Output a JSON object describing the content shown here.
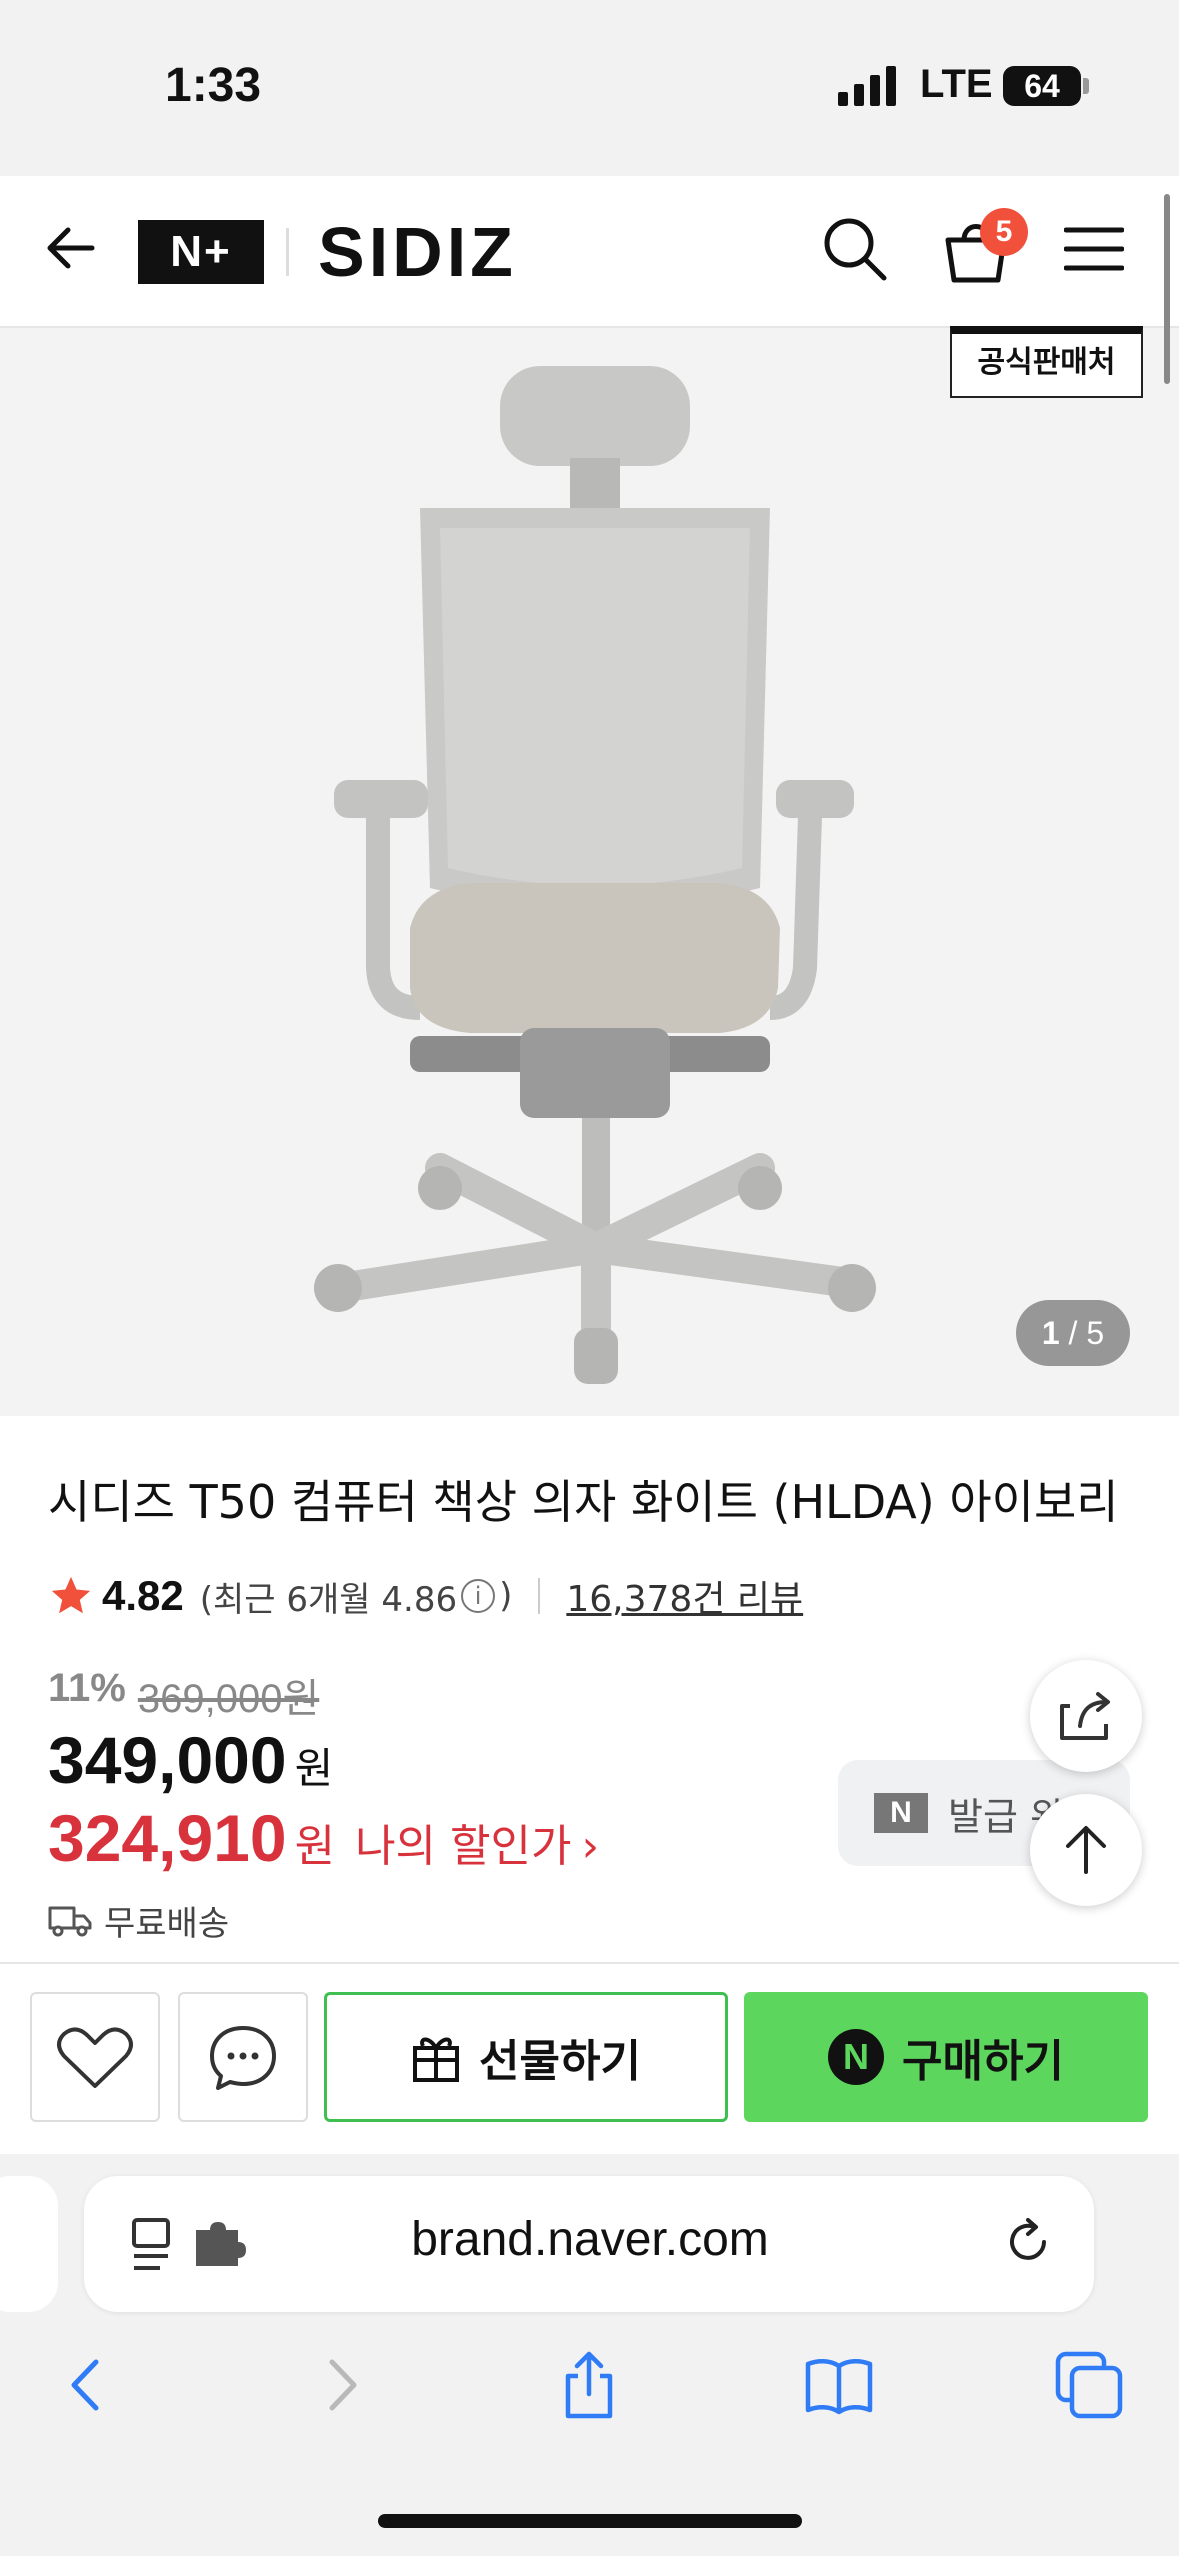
{
  "status": {
    "time": "1:33",
    "network": "LTE",
    "battery": "64"
  },
  "header": {
    "logo": "N+",
    "brand": "SIDIZ",
    "cart_count": "5",
    "official_badge": "공식판매처"
  },
  "gallery": {
    "current": "1",
    "total": "5",
    "separator": "/"
  },
  "product": {
    "title": "시디즈 T50 컴퓨터 책상 의자 화이트 (HLDA) 아이보리",
    "rating": "4.82",
    "recent_prefix": "(최근 6개월 4.86",
    "recent_suffix": ")",
    "reviews": "16,378건 리뷰",
    "discount_rate": "11%",
    "original_price": "369,000원",
    "price": "349,000",
    "price_unit": "원",
    "my_price": "324,910",
    "my_price_unit": "원",
    "my_price_label": "나의 할인가",
    "shipping": "무료배송",
    "coupon_label": "발급 완료"
  },
  "actions": {
    "gift": "선물하기",
    "buy": "구매하기",
    "buy_icon": "N"
  },
  "browser": {
    "url": "brand.naver.com"
  },
  "colors": {
    "buy_green": "#5cd65c",
    "sale_red": "#d8323c",
    "badge_red": "#f1503b"
  }
}
